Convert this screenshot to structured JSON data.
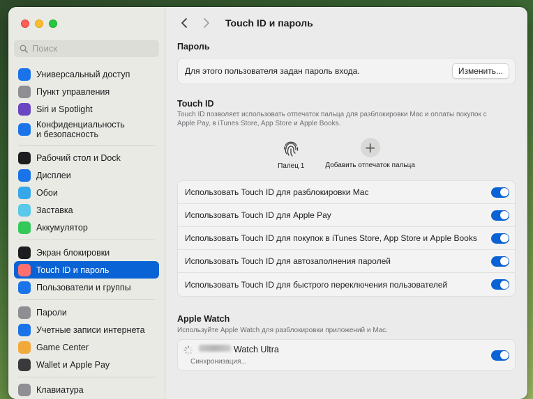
{
  "window": {
    "title": "Touch ID и пароль"
  },
  "search": {
    "placeholder": "Поиск"
  },
  "sidebar": {
    "groups": [
      [
        {
          "label": "Универсальный доступ",
          "icon": "accessibility-icon",
          "color": "#1a73e8"
        },
        {
          "label": "Пункт управления",
          "icon": "control-center-icon",
          "color": "#8e8e93"
        },
        {
          "label": "Siri и Spotlight",
          "icon": "siri-icon",
          "color": "#6b46c1"
        },
        {
          "label": "Конфиденциальность\nи безопасность",
          "icon": "privacy-hand-icon",
          "color": "#1a73e8"
        }
      ],
      [
        {
          "label": "Рабочий стол и Dock",
          "icon": "dock-icon",
          "color": "#1d1d1f"
        },
        {
          "label": "Дисплеи",
          "icon": "display-icon",
          "color": "#1a73e8"
        },
        {
          "label": "Обои",
          "icon": "wallpaper-icon",
          "color": "#36a7e8"
        },
        {
          "label": "Заставка",
          "icon": "screensaver-icon",
          "color": "#5ac8e8"
        },
        {
          "label": "Аккумулятор",
          "icon": "battery-icon",
          "color": "#34c759"
        }
      ],
      [
        {
          "label": "Экран блокировки",
          "icon": "lock-screen-icon",
          "color": "#1d1d1f"
        },
        {
          "label": "Touch ID и пароль",
          "icon": "fingerprint-icon",
          "color": "#ff6f6f",
          "active": true
        },
        {
          "label": "Пользователи и группы",
          "icon": "users-icon",
          "color": "#1a73e8"
        }
      ],
      [
        {
          "label": "Пароли",
          "icon": "key-icon",
          "color": "#8e8e93"
        },
        {
          "label": "Учетные записи интернета",
          "icon": "at-icon",
          "color": "#1a73e8"
        },
        {
          "label": "Game Center",
          "icon": "game-center-icon",
          "color": "#f2a93b"
        },
        {
          "label": "Wallet и Apple Pay",
          "icon": "wallet-icon",
          "color": "#3a3a3c"
        }
      ]
    ],
    "cut_item": "Клавиатура"
  },
  "password": {
    "heading": "Пароль",
    "text": "Для этого пользователя задан пароль входа.",
    "button": "Изменить..."
  },
  "touchid": {
    "heading": "Touch ID",
    "description": "Touch ID позволяет использовать отпечаток пальца для разблокировки Mac и оплаты покупок с Apple Pay, в iTunes Store, App Store и Apple Books.",
    "finger_label": "Палец 1",
    "add_label": "Добавить отпечаток пальца",
    "options": [
      {
        "label": "Использовать Touch ID для разблокировки Mac",
        "on": true
      },
      {
        "label": "Использовать Touch ID для Apple Pay",
        "on": true
      },
      {
        "label": "Использовать Touch ID для покупок в iTunes Store, App Store и Apple Books",
        "on": true
      },
      {
        "label": "Использовать Touch ID для автозаполнения паролей",
        "on": true
      },
      {
        "label": "Использовать Touch ID для быстрого переключения пользователей",
        "on": true
      }
    ]
  },
  "watch": {
    "heading": "Apple Watch",
    "description": "Используйте Apple Watch для разблокировки приложений и Mac.",
    "name": "Watch Ultra",
    "status": "Синхронизация...",
    "on": true
  },
  "help": "?",
  "colors": {
    "accent": "#0a63d4",
    "annotation_arrow": "#e8362d"
  }
}
